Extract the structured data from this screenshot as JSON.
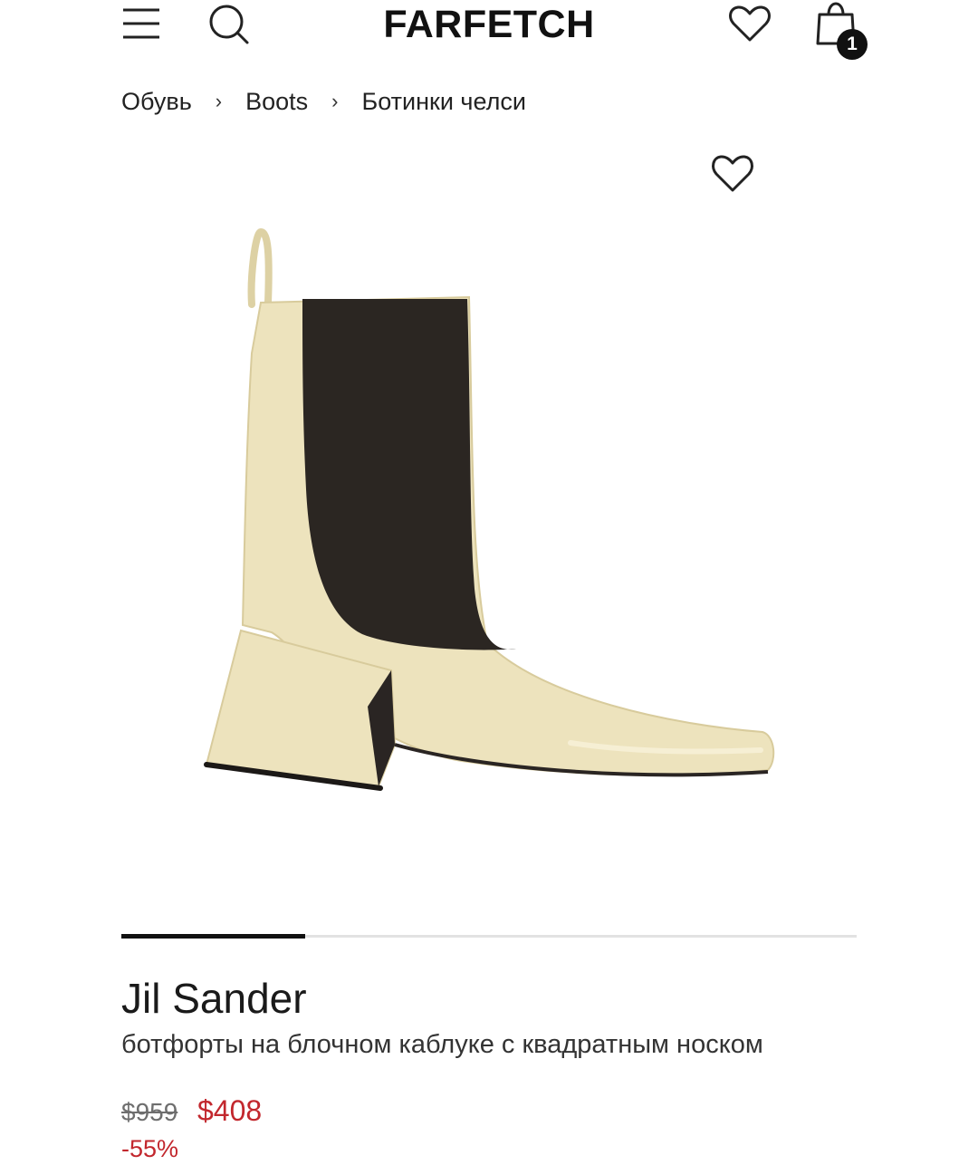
{
  "header": {
    "logo": "FARFETCH",
    "menu_icon": "hamburger-menu-icon",
    "search_icon": "search-icon",
    "wishlist_icon": "heart-icon",
    "bag_icon": "shopping-bag-icon",
    "bag_count": "1"
  },
  "breadcrumb": {
    "items": [
      "Обувь",
      "Boots",
      "Ботинки челси"
    ],
    "separator": "›"
  },
  "product": {
    "image_icon": "chelsea-boot-image",
    "wishlist_icon": "heart-outline-icon",
    "gallery_progress": 0.25,
    "brand": "Jil Sander",
    "description": "ботфорты на блочном каблуке с квадратным носком",
    "price_original": "$959",
    "price_sale": "$408",
    "discount": "-55%"
  },
  "colors": {
    "sale": "#c2272d",
    "boot_leather": "#ede3bd",
    "boot_elastic": "#2b2622",
    "accent": "#111111"
  }
}
